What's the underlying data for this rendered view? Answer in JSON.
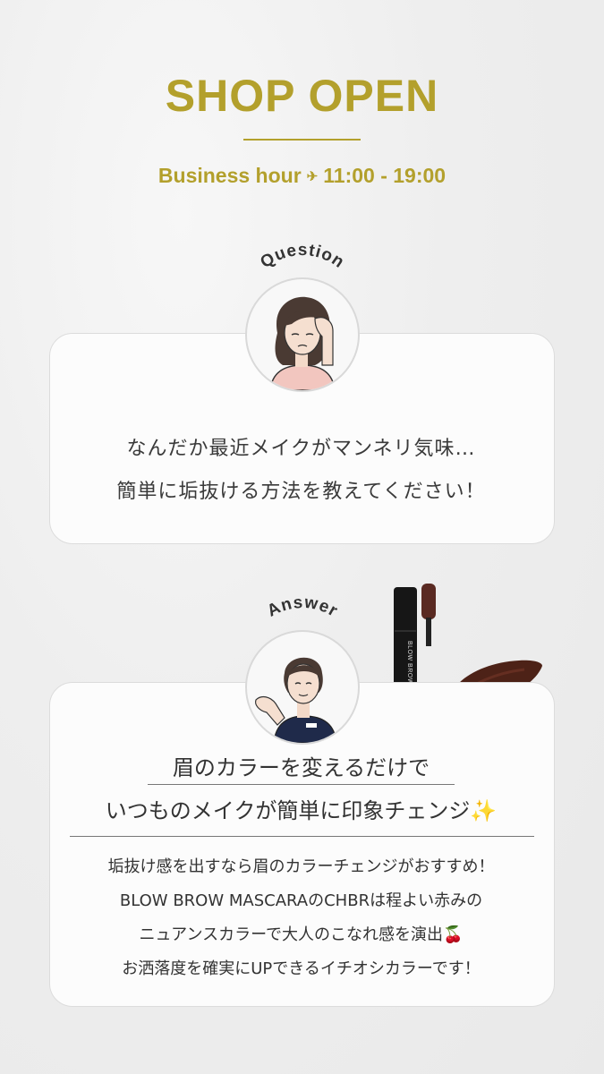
{
  "header": {
    "title": "SHOP OPEN",
    "hours_label": "Business hour",
    "hours_icon": "airplane-icon",
    "hours_value": "11:00 - 19:00",
    "accent_color": "#b3a02c"
  },
  "question": {
    "label": "Question",
    "lines": [
      "なんだか最近メイクがマンネリ気味…",
      "簡単に垢抜ける方法を教えてください！"
    ]
  },
  "answer": {
    "label": "Answer",
    "headline": [
      "眉のカラーを変えるだけで",
      "いつものメイクが簡単に印象チェンジ✨"
    ],
    "body": [
      "垢抜け感を出すなら眉のカラーチェンジがおすすめ！",
      "BLOW BROW MASCARAのCHBRは程よい赤みの",
      "ニュアンスカラーで大人のこなれ感を演出🍒",
      "お洒落度を確実にUPできるイチオシカラーです！"
    ],
    "product_label": "BLOW BROW MASCARA"
  }
}
